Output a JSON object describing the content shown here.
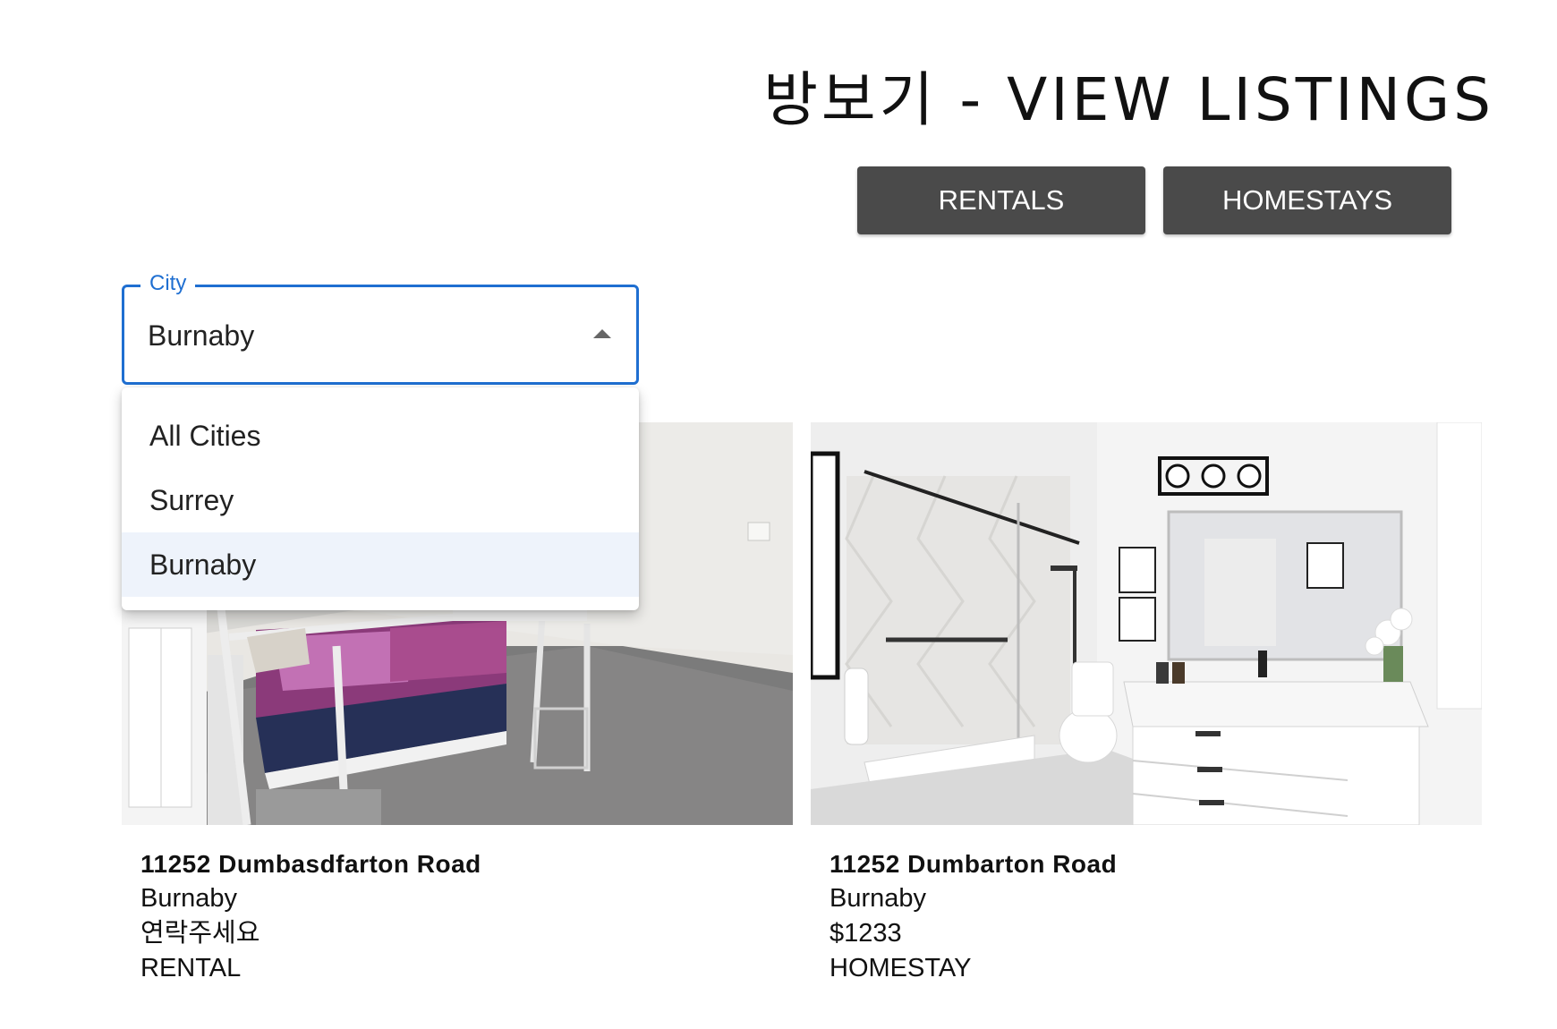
{
  "header": {
    "title": "방보기 - VIEW LISTINGS"
  },
  "tabs": [
    {
      "label": "RENTALS"
    },
    {
      "label": "HOMESTAYS"
    }
  ],
  "city_filter": {
    "label": "City",
    "value": "Burnaby",
    "open": true,
    "options": [
      "All Cities",
      "Surrey",
      "Burnaby"
    ],
    "selected_index": 2
  },
  "listings": [
    {
      "address": "11252 Dumbasdfarton Road",
      "city": "Burnaby",
      "price": "연락주세요",
      "type": "RENTAL",
      "image_icon": "bedroom-photo"
    },
    {
      "address": "11252 Dumbarton Road",
      "city": "Burnaby",
      "price": "$1233",
      "type": "HOMESTAY",
      "image_icon": "bathroom-photo"
    }
  ],
  "colors": {
    "accent": "#1f6fd1",
    "button_bg": "#4a4a4a",
    "option_selected_bg": "#eef3fb"
  }
}
